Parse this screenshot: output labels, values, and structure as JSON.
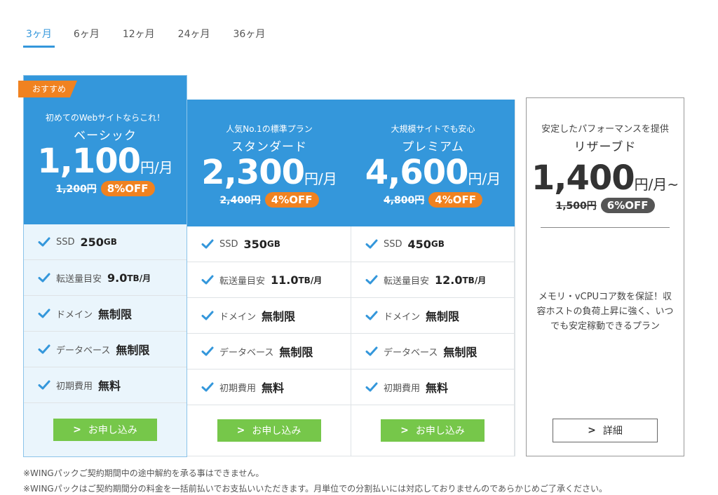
{
  "tabs": [
    {
      "label": "3ヶ月",
      "active": true
    },
    {
      "label": "6ヶ月",
      "active": false
    },
    {
      "label": "12ヶ月",
      "active": false
    },
    {
      "label": "24ヶ月",
      "active": false
    },
    {
      "label": "36ヶ月",
      "active": false
    }
  ],
  "plans": {
    "basic": {
      "badge": "おすすめ",
      "subtitle": "初めてのWebサイトならこれ！",
      "name": "ベーシック",
      "price": "1,100",
      "unit": "円/月",
      "original": "1,200円",
      "discount": "8%OFF",
      "features": [
        {
          "label": "SSD",
          "value": "250",
          "unit": "GB"
        },
        {
          "label": "転送量目安",
          "value": "9.0",
          "unit": "TB/月"
        },
        {
          "label": "ドメイン",
          "value": "無制限",
          "unit": ""
        },
        {
          "label": "データベース",
          "value": "無制限",
          "unit": ""
        },
        {
          "label": "初期費用",
          "value": "無料",
          "unit": ""
        }
      ],
      "apply_label": "お申し込み"
    },
    "standard": {
      "subtitle": "人気No.1の標準プラン",
      "name": "スタンダード",
      "price": "2,300",
      "unit": "円/月",
      "original": "2,400円",
      "discount": "4%OFF",
      "features": [
        {
          "label": "SSD",
          "value": "350",
          "unit": "GB"
        },
        {
          "label": "転送量目安",
          "value": "11.0",
          "unit": "TB/月"
        },
        {
          "label": "ドメイン",
          "value": "無制限",
          "unit": ""
        },
        {
          "label": "データベース",
          "value": "無制限",
          "unit": ""
        },
        {
          "label": "初期費用",
          "value": "無料",
          "unit": ""
        }
      ],
      "apply_label": "お申し込み"
    },
    "premium": {
      "subtitle": "大規模サイトでも安心",
      "name": "プレミアム",
      "price": "4,600",
      "unit": "円/月",
      "original": "4,800円",
      "discount": "4%OFF",
      "features": [
        {
          "label": "SSD",
          "value": "450",
          "unit": "GB"
        },
        {
          "label": "転送量目安",
          "value": "12.0",
          "unit": "TB/月"
        },
        {
          "label": "ドメイン",
          "value": "無制限",
          "unit": ""
        },
        {
          "label": "データベース",
          "value": "無制限",
          "unit": ""
        },
        {
          "label": "初期費用",
          "value": "無料",
          "unit": ""
        }
      ],
      "apply_label": "お申し込み"
    },
    "reserved": {
      "subtitle": "安定したパフォーマンスを提供",
      "name": "リザーブド",
      "price": "1,400",
      "unit": "円/月~",
      "original": "1,500円",
      "discount": "6%OFF",
      "description": "メモリ・vCPUコア数を保証！収容ホストの負荷上昇に強く、いつでも安定稼動できるプラン",
      "detail_label": "詳細"
    }
  },
  "notes": [
    "※WINGパックご契約期間中の途中解約を承る事はできません。",
    "※WINGパックはご契約期間分の料金を一括前払いでお支払いいただきます。月単位での分割払いには対応しておりませんのであらかじめご了承ください。"
  ],
  "colors": {
    "primary": "#3497db",
    "accent": "#f08220",
    "apply": "#76c74a",
    "reserved_badge": "#555555"
  },
  "icons": {
    "feature": "check-icon",
    "button": "chevron-right-icon"
  }
}
